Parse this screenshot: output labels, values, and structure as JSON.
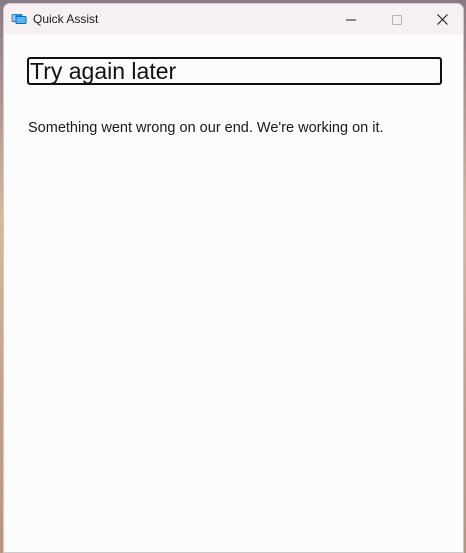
{
  "window": {
    "title": "Quick Assist",
    "icon": "quick-assist-icon"
  },
  "controls": {
    "minimize_icon": "minimize-icon",
    "maximize_icon": "maximize-icon",
    "close_icon": "close-icon"
  },
  "main": {
    "heading": "Try again later",
    "message": "Something went wrong on our end. We're working on it."
  },
  "colors": {
    "titlebar": "#f7f0f0",
    "content_bg": "#fcfcfd",
    "icon_blue": "#0f6cbd"
  }
}
